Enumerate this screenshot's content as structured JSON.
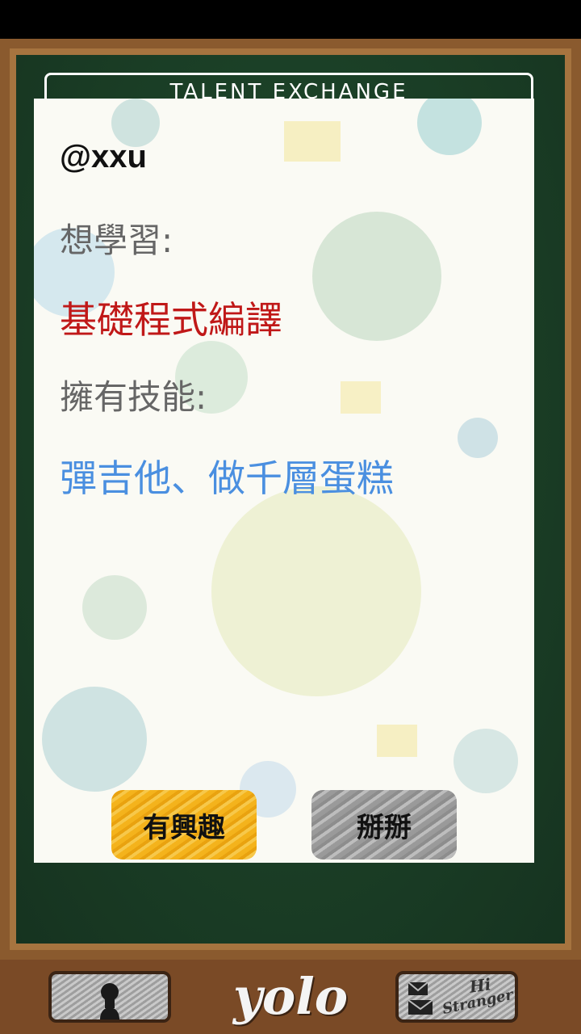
{
  "header": {
    "title": "TALENT EXCHANGE"
  },
  "card": {
    "username": "@xxu",
    "want_label": "想學習:",
    "want_value": "基礎程式編譯",
    "have_label": "擁有技能:",
    "have_value": "彈吉他、做千層蛋糕",
    "interested_label": "有興趣",
    "bye_label": "掰掰"
  },
  "bottom": {
    "logo": "yolo",
    "hi_title": "Hi",
    "hi_subtitle": "Stranger",
    "profile_icon": "person-silhouette-icon",
    "hi_icon": "envelope-icon"
  },
  "colors": {
    "board": "#1a3d25",
    "frame": "#8a5a2e",
    "want": "#c01818",
    "have": "#4a8fe0",
    "interested": "#f4b31c",
    "bye": "#9a9a9a"
  }
}
